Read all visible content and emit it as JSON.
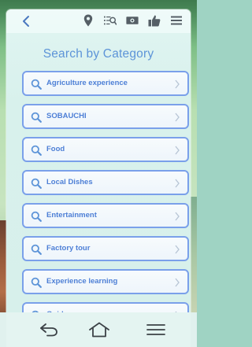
{
  "header": {
    "back_icon": "back-arrow-icon",
    "icons": [
      "map-pin-icon",
      "list-search-icon",
      "photo-icon",
      "thumbs-up-icon",
      "hamburger-menu-icon"
    ]
  },
  "page": {
    "title": "Search by Category"
  },
  "categories": [
    {
      "label": "Agriculture experience"
    },
    {
      "label": "SOBAUCHI"
    },
    {
      "label": "Food"
    },
    {
      "label": "Local Dishes"
    },
    {
      "label": "Entertainment"
    },
    {
      "label": "Factory tour"
    },
    {
      "label": "Experience learning"
    },
    {
      "label": "Guide"
    }
  ],
  "navbar": {
    "icons": [
      "back-icon",
      "home-icon",
      "recent-apps-icon"
    ]
  },
  "colors": {
    "accent": "#5d94d8",
    "item_border": "#7aa0ea",
    "item_text": "#4d7fd6",
    "icon_dark": "#555f66"
  }
}
